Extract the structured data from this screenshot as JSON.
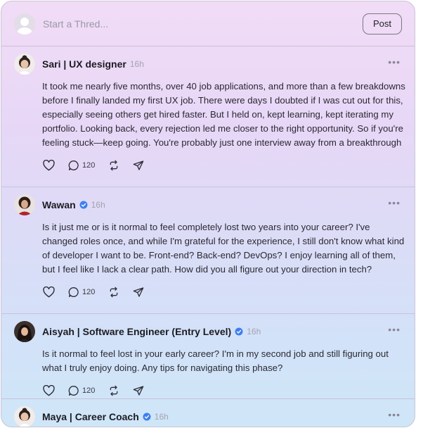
{
  "composer": {
    "placeholder": "Start a Thred...",
    "post_label": "Post"
  },
  "threads": [
    {
      "author": "Sari | UX designer",
      "verified": false,
      "time": "16h",
      "text": "It took me nearly five months, over 40 job applications, and more than a few breakdowns before I finally landed my first UX job. There were days I doubted if I was cut out for this, especially seeing others get hired faster. But I held on, kept learning, kept iterating my portfolio. Looking back, every rejection led me closer to the right opportunity. So if you're feeling stuck—keep going. You're probably just one interview away from a breakthrough",
      "reply_count": "120",
      "more": "•••"
    },
    {
      "author": "Wawan",
      "verified": true,
      "time": "16h",
      "text": "Is it just me or is it normal to feel completely lost two years into your career? I've changed roles once, and while I'm grateful for the experience, I still don't know what kind of developer I want to be. Front-end? Back-end? DevOps? I enjoy learning all of them, but I feel like I lack a clear path. How did you all figure out your direction in tech?",
      "reply_count": "120",
      "more": "•••"
    },
    {
      "author": "Aisyah | Software Engineer (Entry Level)",
      "verified": true,
      "time": "16h",
      "text": "Is it normal to feel lost in your early career? I'm in my second job and still figuring out what I truly enjoy doing. Any tips for navigating this phase?",
      "reply_count": "120",
      "more": "•••"
    },
    {
      "author": "Maya | Career Coach",
      "verified": true,
      "time": "16h",
      "text": "",
      "reply_count": "",
      "more": "•••"
    }
  ],
  "colors": {
    "verified": "#3d7ff0",
    "muted": "#a6a2b1"
  },
  "icons": [
    "heart-icon",
    "comment-icon",
    "repost-icon",
    "share-icon",
    "more-icon",
    "verified-badge-icon"
  ]
}
